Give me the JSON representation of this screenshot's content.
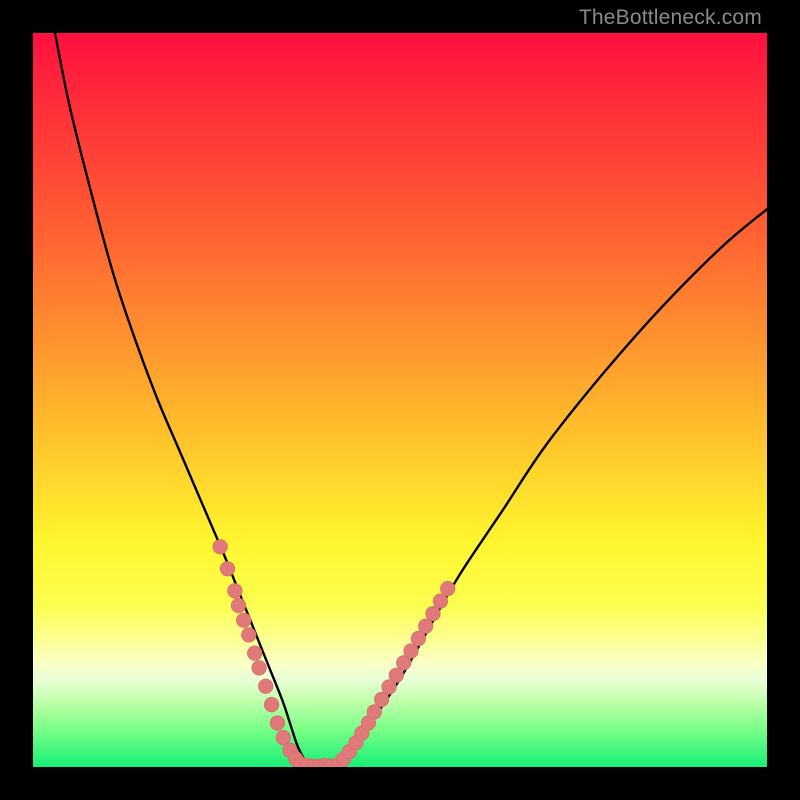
{
  "watermark": "TheBottleneck.com",
  "colors": {
    "page_bg": "#000000",
    "curve": "#000000",
    "marker_fill": "#e07a7a",
    "marker_stroke": "#d96a6a",
    "gradient_top": "#ff103e",
    "gradient_bottom": "#17ef77"
  },
  "chart_data": {
    "type": "line",
    "title": "",
    "xlabel": "",
    "ylabel": "",
    "xlim": [
      0,
      100
    ],
    "ylim": [
      0,
      100
    ],
    "grid": false,
    "legend_position": "none",
    "series": [
      {
        "name": "bottleneck-curve",
        "x": [
          3,
          5,
          8,
          11,
          14,
          17,
          20,
          23,
          26,
          28,
          30,
          32,
          34,
          35,
          36,
          37,
          38,
          40,
          42,
          44,
          46,
          50,
          54,
          58,
          64,
          70,
          78,
          86,
          94,
          100
        ],
        "values": [
          100,
          90,
          78,
          67,
          58,
          50,
          43,
          36,
          29,
          24,
          19,
          14,
          9,
          6,
          3,
          1,
          0,
          0,
          1,
          3,
          6,
          12,
          19,
          26,
          35,
          44,
          54,
          63,
          71,
          76
        ]
      }
    ],
    "markers": {
      "left_cluster": {
        "note": "dense salmon dots on the descending (left) branch near the valley",
        "points": [
          {
            "x": 25.5,
            "y": 30.0
          },
          {
            "x": 26.5,
            "y": 27.0
          },
          {
            "x": 27.5,
            "y": 24.0
          },
          {
            "x": 28.0,
            "y": 22.0
          },
          {
            "x": 28.7,
            "y": 20.0
          },
          {
            "x": 29.4,
            "y": 18.0
          },
          {
            "x": 30.2,
            "y": 15.5
          },
          {
            "x": 30.8,
            "y": 13.5
          },
          {
            "x": 31.7,
            "y": 11.0
          },
          {
            "x": 32.5,
            "y": 8.5
          },
          {
            "x": 33.3,
            "y": 6.0
          },
          {
            "x": 34.1,
            "y": 4.0
          },
          {
            "x": 35.0,
            "y": 2.3
          },
          {
            "x": 35.8,
            "y": 1.1
          }
        ]
      },
      "bottom_cluster": {
        "note": "flat run of dots at the minimum",
        "points": [
          {
            "x": 36.5,
            "y": 0.4
          },
          {
            "x": 37.3,
            "y": 0.2
          },
          {
            "x": 38.2,
            "y": 0.1
          },
          {
            "x": 39.0,
            "y": 0.1
          },
          {
            "x": 39.8,
            "y": 0.2
          },
          {
            "x": 40.7,
            "y": 0.1
          },
          {
            "x": 41.5,
            "y": 0.3
          }
        ]
      },
      "right_cluster": {
        "note": "dense salmon dots on the ascending (right) branch near the valley",
        "points": [
          {
            "x": 42.3,
            "y": 1.1
          },
          {
            "x": 43.1,
            "y": 2.1
          },
          {
            "x": 44.0,
            "y": 3.3
          },
          {
            "x": 44.8,
            "y": 4.6
          },
          {
            "x": 45.7,
            "y": 6.0
          },
          {
            "x": 46.5,
            "y": 7.5
          },
          {
            "x": 47.5,
            "y": 9.2
          },
          {
            "x": 48.5,
            "y": 10.9
          },
          {
            "x": 49.5,
            "y": 12.5
          },
          {
            "x": 50.5,
            "y": 14.2
          },
          {
            "x": 51.5,
            "y": 15.8
          },
          {
            "x": 52.5,
            "y": 17.5
          },
          {
            "x": 53.5,
            "y": 19.2
          },
          {
            "x": 54.5,
            "y": 20.9
          },
          {
            "x": 55.5,
            "y": 22.6
          },
          {
            "x": 56.5,
            "y": 24.3
          }
        ]
      }
    }
  }
}
